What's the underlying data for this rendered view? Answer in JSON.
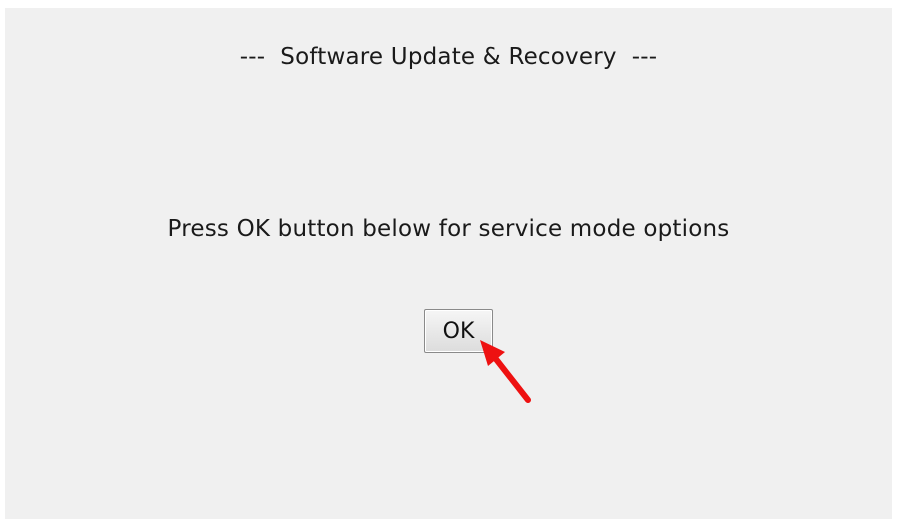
{
  "dialog": {
    "title": "---  Software Update & Recovery  ---",
    "message": "Press OK button below for service mode options",
    "ok_label": "OK"
  },
  "annotation": {
    "arrow_color": "#ee1111",
    "icon": "red-pointer-arrow-icon"
  }
}
